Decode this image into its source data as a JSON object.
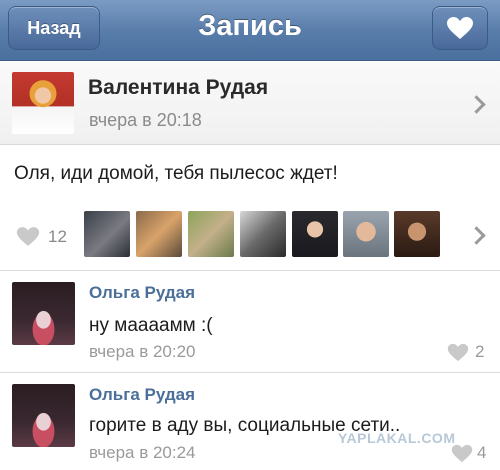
{
  "navbar": {
    "back_label": "Назад",
    "title": "Запись",
    "favorite_icon": "heart-icon"
  },
  "post": {
    "author_name": "Валентина Рудая",
    "time": "вчера в 20:18",
    "text": "Оля, иди домой, тебя пылесос ждет!",
    "likes_count": "12",
    "likers_count_shown": 7
  },
  "comments": [
    {
      "author": "Ольга Рудая",
      "text": "ну маааамм :(",
      "time": "вчера в 20:20",
      "likes": "2"
    },
    {
      "author": "Ольга Рудая",
      "text": "горите в аду вы, социальные сети..",
      "time": "вчера в 20:24",
      "likes": "4"
    }
  ],
  "watermark": "YAPLAKAL.COM",
  "colors": {
    "navbar": "#5a7eab",
    "comment_author": "#4a6f9a"
  }
}
